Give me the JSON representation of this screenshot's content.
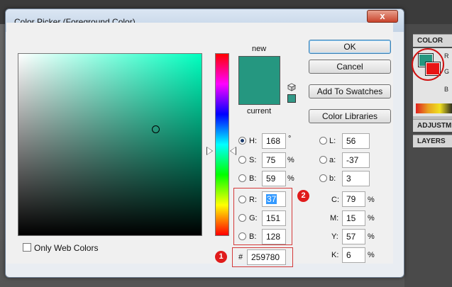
{
  "dialog": {
    "title": "Color Picker (Foreground Color)",
    "close_glyph": "x"
  },
  "buttons": {
    "ok": "OK",
    "cancel": "Cancel",
    "add_to_swatches": "Add To Swatches",
    "color_libraries": "Color Libraries"
  },
  "preview": {
    "new_label": "new",
    "current_label": "current",
    "new_color": "#259780",
    "current_color": "#259780",
    "websafe_color": "#339988"
  },
  "hsb": {
    "h": {
      "label": "H:",
      "value": "168",
      "unit": "°"
    },
    "s": {
      "label": "S:",
      "value": "75",
      "unit": "%"
    },
    "b": {
      "label": "B:",
      "value": "59",
      "unit": "%"
    }
  },
  "rgb": {
    "r": {
      "label": "R:",
      "value": "37"
    },
    "g": {
      "label": "G:",
      "value": "151"
    },
    "b": {
      "label": "B:",
      "value": "128"
    }
  },
  "lab": {
    "l": {
      "label": "L:",
      "value": "56"
    },
    "a": {
      "label": "a:",
      "value": "-37"
    },
    "b": {
      "label": "b:",
      "value": "3"
    }
  },
  "cmyk": {
    "c": {
      "label": "C:",
      "value": "79",
      "unit": "%"
    },
    "m": {
      "label": "M:",
      "value": "15",
      "unit": "%"
    },
    "y": {
      "label": "Y:",
      "value": "57",
      "unit": "%"
    },
    "k": {
      "label": "K:",
      "value": "6",
      "unit": "%"
    }
  },
  "hex": {
    "label": "#",
    "value": "259780"
  },
  "only_web_colors": "Only Web Colors",
  "badges": {
    "one": "1",
    "two": "2"
  },
  "side_panel": {
    "color_tab": "COLOR",
    "adjustments_tab": "ADJUSTME",
    "layers_tab": "LAYERS",
    "letter_r": "R",
    "letter_g": "G",
    "letter_b": "B",
    "foreground_color": "#259780",
    "background_color": "#e81515"
  },
  "colors": {
    "annotation_red": "#d43a3a",
    "hue_indicator": "#ffffff"
  }
}
